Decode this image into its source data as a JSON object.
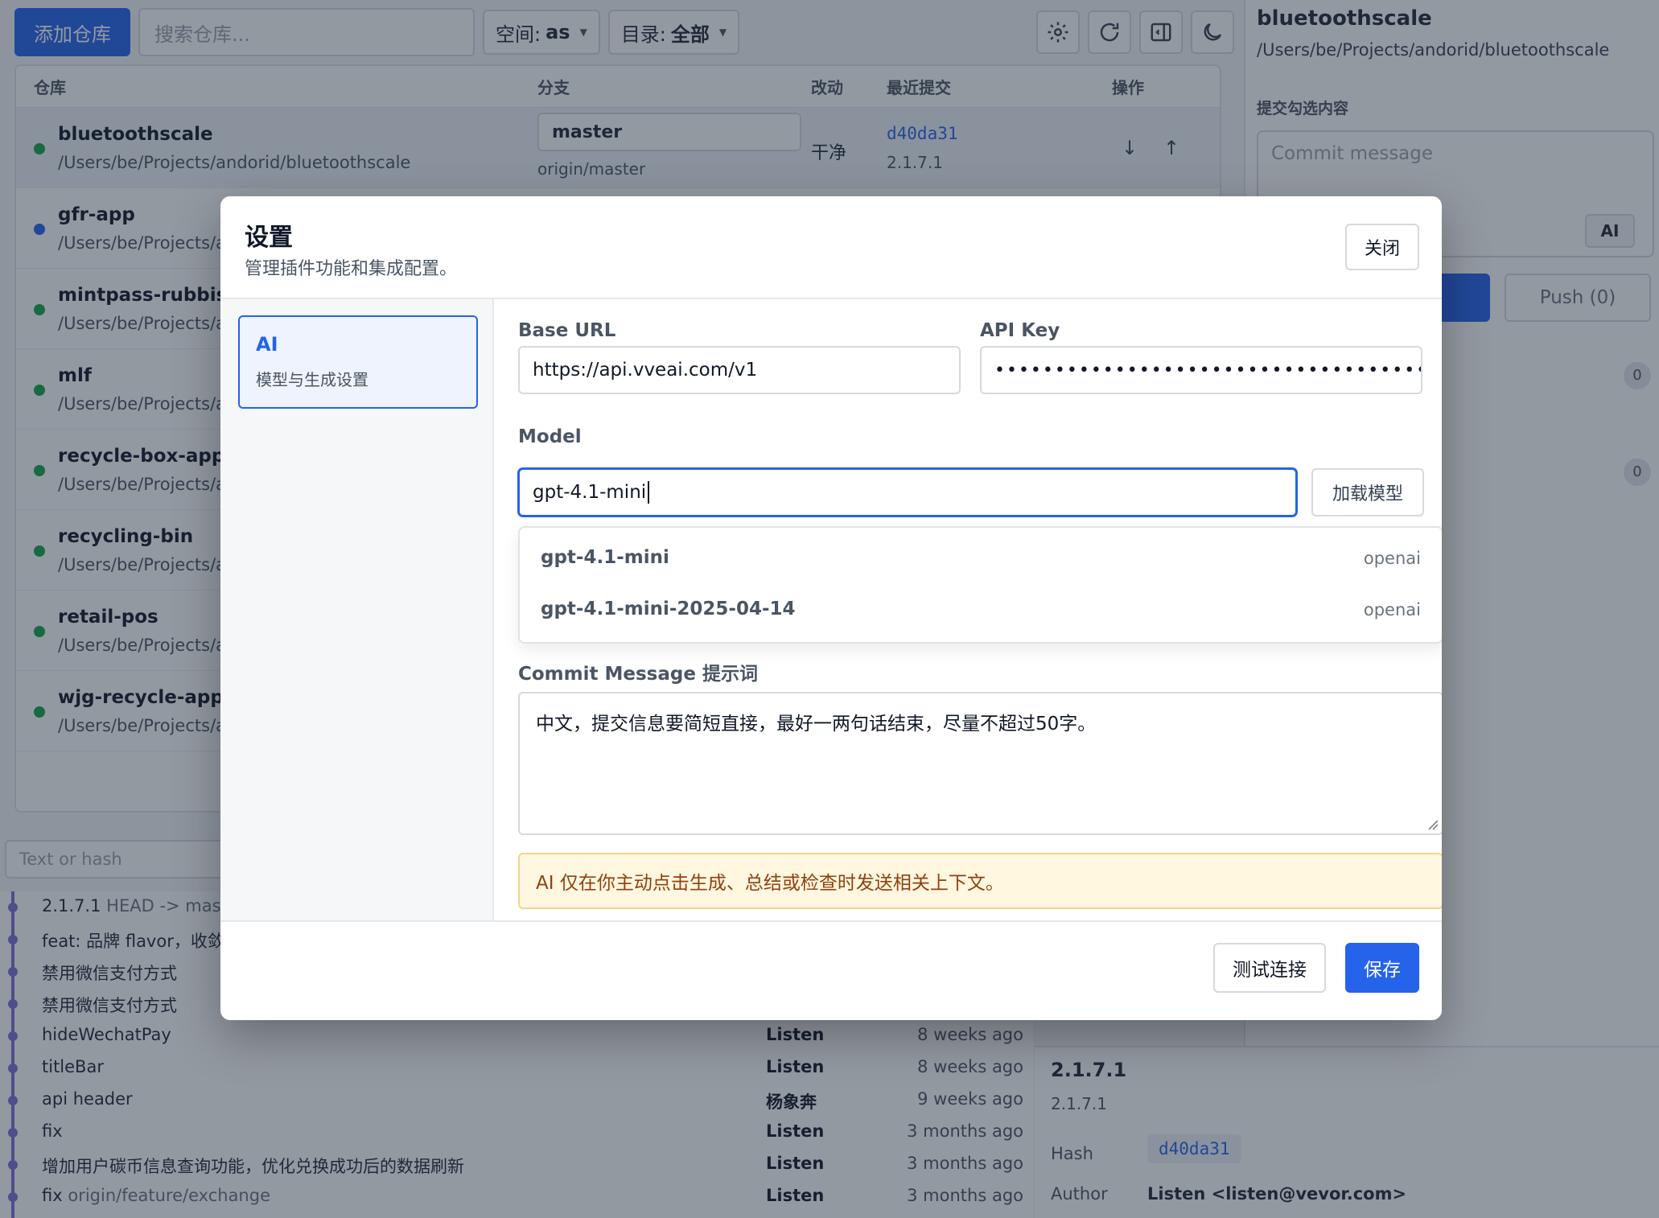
{
  "toolbar": {
    "add_repo": "添加仓库",
    "search_placeholder": "搜索仓库...",
    "space_label": "空间:",
    "space_value": "as",
    "dir_label": "目录:",
    "dir_value": "全部"
  },
  "repo_table": {
    "columns": [
      "仓库",
      "分支",
      "改动",
      "最近提交",
      "操作"
    ],
    "rows": [
      {
        "name": "bluetoothscale",
        "path": "/Users/be/Projects/andorid/bluetoothscale",
        "branch": "master",
        "upstream": "origin/master",
        "changes": "干净",
        "hash": "d40da31",
        "tag": "2.1.7.1",
        "status": "green"
      },
      {
        "name": "gfr-app",
        "path": "/Users/be/Projects/a",
        "status": "blue"
      },
      {
        "name": "mintpass-rubbish",
        "path": "/Users/be/Projects/a",
        "status": "green"
      },
      {
        "name": "mlf",
        "path": "/Users/be/Projects/a",
        "status": "green"
      },
      {
        "name": "recycle-box-app",
        "path": "/Users/be/Projects/a",
        "status": "green"
      },
      {
        "name": "recycling-bin",
        "path": "/Users/be/Projects/a",
        "status": "green"
      },
      {
        "name": "retail-pos",
        "path": "/Users/be/Projects/a",
        "status": "green"
      },
      {
        "name": "wjg-recycle-app",
        "path": "/Users/be/Projects/a",
        "status": "green"
      }
    ]
  },
  "history": {
    "filter_placeholder": "Text or hash",
    "rows": [
      {
        "msg": "2.1.7.1",
        "ref": "HEAD -> maste",
        "author": "",
        "time": ""
      },
      {
        "msg": "feat: 品牌 flavor，收敛",
        "ref": "",
        "author": "",
        "time": ""
      },
      {
        "msg": "禁用微信支付方式",
        "ref": "",
        "author": "",
        "time": ""
      },
      {
        "msg": "禁用微信支付方式",
        "ref": "",
        "author": "",
        "time": ""
      },
      {
        "msg": "hideWechatPay",
        "ref": "",
        "author": "Listen",
        "time": "8 weeks ago"
      },
      {
        "msg": "titleBar",
        "ref": "",
        "author": "Listen",
        "time": "8 weeks ago"
      },
      {
        "msg": "api header",
        "ref": "",
        "author": "杨象奔",
        "time": "9 weeks ago"
      },
      {
        "msg": "fix",
        "ref": "",
        "author": "Listen",
        "time": "3 months ago"
      },
      {
        "msg": "增加用户碳币信息查询功能，优化兑换成功后的数据刷新",
        "ref": "",
        "author": "Listen",
        "time": "3 months ago"
      },
      {
        "msg": "fix",
        "ref": "origin/feature/exchange",
        "author": "Listen",
        "time": "3 months ago"
      }
    ]
  },
  "side": {
    "title": "bluetoothscale",
    "path": "/Users/be/Projects/andorid/bluetoothscale",
    "section_label": "提交勾选内容",
    "commit_placeholder": "Commit message",
    "ai_label": "AI",
    "push_label": "Push (0)",
    "badge1": "0",
    "badge2": "0"
  },
  "detail": {
    "title": "2.1.7.1",
    "subtitle": "2.1.7.1",
    "hash_label": "Hash",
    "hash_value": "d40da31",
    "author_label": "Author",
    "author_value": "Listen <listen@vevor.com>"
  },
  "modal": {
    "title": "设置",
    "subtitle": "管理插件功能和集成配置。",
    "close_label": "关闭",
    "nav": {
      "title": "AI",
      "subtitle": "模型与生成设置"
    },
    "base_url_label": "Base URL",
    "base_url_value": "https://api.vveai.com/v1",
    "api_key_label": "API Key",
    "api_key_masked": "••••••••••••••••••••••••••••••••••••••••••••••••••",
    "model_label": "Model",
    "model_value": "gpt-4.1-mini",
    "load_models": "加载模型",
    "suggestions": [
      {
        "name": "gpt-4.1-mini",
        "provider": "openai"
      },
      {
        "name": "gpt-4.1-mini-2025-04-14",
        "provider": "openai"
      }
    ],
    "prompt_label": "Commit Message 提示词",
    "prompt_value": "中文，提交信息要简短直接，最好一两句话结束，尽量不超过50字。",
    "notice": "AI 仅在你主动点击生成、总结或检查时发送相关上下文。",
    "test_label": "测试连接",
    "save_label": "保存"
  }
}
